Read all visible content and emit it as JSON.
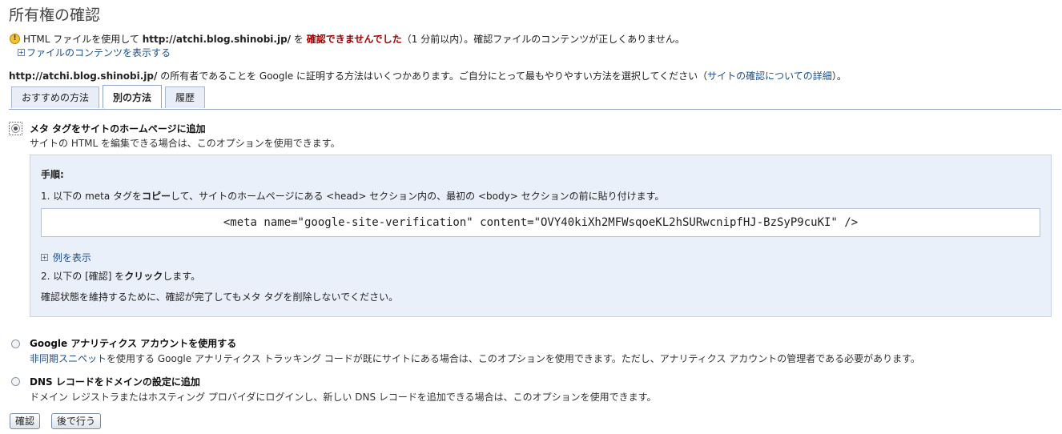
{
  "title": "所有権の確認",
  "warning": {
    "pre": "HTML ファイルを使用して",
    "url": "http://atchi.blog.shinobi.jp/",
    "mid": "を",
    "failed": "確認できませんでした",
    "post": "（1 分前以内）。確認ファイルのコンテンツが正しくありません。",
    "expand_link": "ファイルのコンテンツを表示する"
  },
  "intro": {
    "url": "http://atchi.blog.shinobi.jp/",
    "text": "の所有者であることを Google に証明する方法はいくつかあります。ご自分にとって最もやりやすい方法を選択してください（",
    "link": "サイトの確認についての詳細",
    "close": "）。"
  },
  "tabs": [
    {
      "label": "おすすめの方法",
      "active": false
    },
    {
      "label": "別の方法",
      "active": true
    },
    {
      "label": "履歴",
      "active": false
    }
  ],
  "options": {
    "meta": {
      "title": "メタ タグをサイトのホームページに追加",
      "desc": "サイトの HTML を編集できる場合は、このオプションを使用できます。",
      "selected": true
    },
    "analytics": {
      "title": "Google アナリティクス アカウントを使用する",
      "desc_link": "非同期スニペット",
      "desc": "を使用する Google アナリティクス トラッキング コードが既にサイトにある場合は、このオプションを使用できます。ただし、アナリティクス アカウントの管理者である必要があります。",
      "selected": false
    },
    "dns": {
      "title": "DNS レコードをドメインの設定に追加",
      "desc": "ドメイン レジストラまたはホスティング プロバイダにログインし、新しい DNS レコードを追加できる場合は、このオプションを使用できます。",
      "selected": false
    }
  },
  "instructions": {
    "heading": "手順:",
    "step1_a": "1. 以下の meta タグを",
    "step1_bold": "コピー",
    "step1_b": "して、サイトのホームページにある <head> セクション内の、最初の <body> セクションの前に貼り付けます。",
    "meta_tag": "<meta name=\"google-site-verification\" content=\"OVY40kiXh2MFWsqoeKL2hSURwcnipfHJ-BzSyP9cuKI\" />",
    "example_link": "例を表示",
    "step2_a": "2. 以下の [確認] を",
    "step2_bold": "クリック",
    "step2_b": "します。",
    "note": "確認状態を維持するために、確認が完了してもメタ タグを削除しないでください。"
  },
  "buttons": {
    "verify": "確認",
    "later": "後で行う"
  },
  "colors": {
    "error": "#a40000",
    "link": "#1a4e8a",
    "panel_bg": "#eaf0fa"
  }
}
